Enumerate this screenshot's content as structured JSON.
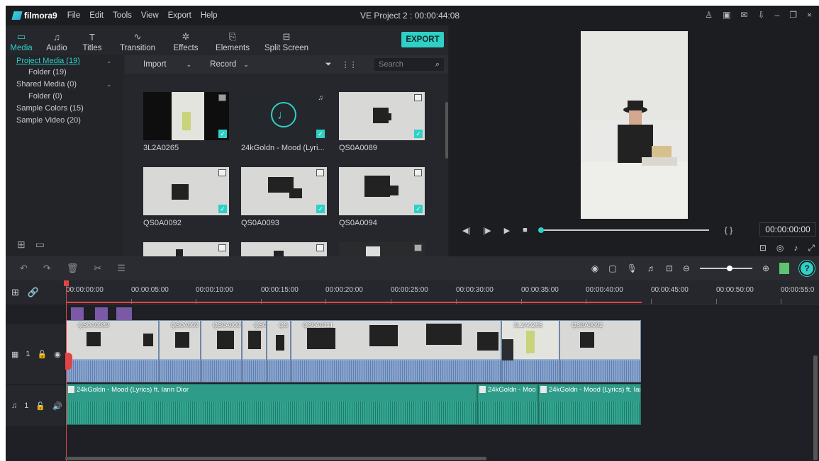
{
  "app": {
    "logo_text": "filmora9",
    "window_title": "VE Project 2 : 00:00:44:08",
    "accent": "#2fd0c6"
  },
  "menu": [
    "File",
    "Edit",
    "Tools",
    "View",
    "Export",
    "Help"
  ],
  "window_controls": [
    "user-icon",
    "save-icon",
    "mail-icon",
    "download-icon",
    "minimize-icon",
    "restore-icon",
    "close-icon"
  ],
  "tabs": [
    {
      "label": "Media",
      "icon": "folder-icon",
      "active": true
    },
    {
      "label": "Audio",
      "icon": "music-note-icon"
    },
    {
      "label": "Titles",
      "icon": "text-icon"
    },
    {
      "label": "Transition",
      "icon": "transition-icon"
    },
    {
      "label": "Effects",
      "icon": "effects-icon"
    },
    {
      "label": "Elements",
      "icon": "elements-icon"
    },
    {
      "label": "Split Screen",
      "icon": "split-screen-icon"
    }
  ],
  "export_label": "EXPORT",
  "sidebar": [
    {
      "label": "Project Media (19)",
      "active": true,
      "has_chevron": true
    },
    {
      "label": "Folder (19)"
    },
    {
      "label": "Shared Media (0)",
      "has_chevron": true
    },
    {
      "label": "Folder (0)"
    },
    {
      "label": "Sample Colors (15)"
    },
    {
      "label": "Sample Video (20)"
    }
  ],
  "media_toolbar": {
    "import": "Import",
    "record": "Record",
    "search_placeholder": "Search"
  },
  "media_items": [
    {
      "label": "3L2A0265",
      "type": "image"
    },
    {
      "label": "24kGoldn - Mood (Lyri...",
      "type": "audio"
    },
    {
      "label": "QS0A0089",
      "type": "video"
    },
    {
      "label": "QS0A0092",
      "type": "video"
    },
    {
      "label": "QS0A0093",
      "type": "video"
    },
    {
      "label": "QS0A0094",
      "type": "video"
    },
    {
      "label": "",
      "type": "video"
    },
    {
      "label": "",
      "type": "video"
    },
    {
      "label": "",
      "type": "video"
    }
  ],
  "preview": {
    "timecode": "00:00:00:00",
    "brackets": "{ }",
    "progress": 0.0
  },
  "ruler_ticks": [
    "00:00:00:00",
    "00:00:05:00",
    "00:00:10:00",
    "00:00:15:00",
    "00:00:20:00",
    "00:00:25:00",
    "00:00:30:00",
    "00:00:35:00",
    "00:00:40:00",
    "00:00:45:00",
    "00:00:50:00",
    "00:00:55:0"
  ],
  "video_clips": [
    "QS0A0089",
    "QS0A009",
    "QS0A009",
    "QS0",
    "QS",
    "QS0A0111",
    "3L2A0265",
    "QS0A0092"
  ],
  "audio_clips": [
    "24kGoldn - Mood (Lyrics) ft. Iann Dior",
    "24kGoldn - Moo",
    "24kGoldn - Mood (Lyrics) ft. Iar"
  ],
  "tracks": {
    "video_label": "1",
    "audio_label": "1"
  }
}
